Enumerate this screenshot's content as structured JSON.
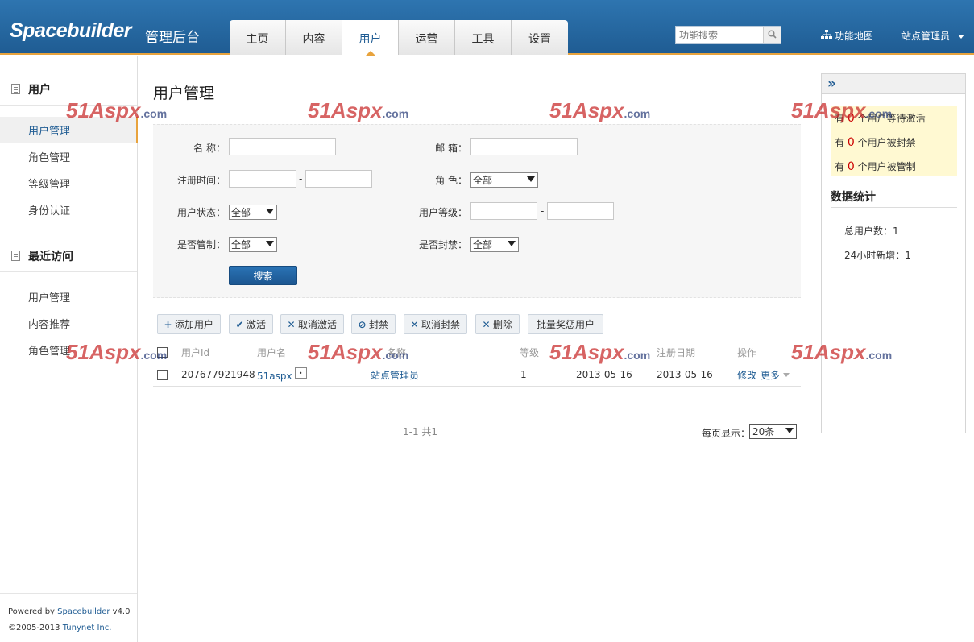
{
  "header": {
    "logo": "Spacebuilder",
    "subtitle": "管理后台",
    "tabs": [
      {
        "label": "主页"
      },
      {
        "label": "内容"
      },
      {
        "label": "用户",
        "active": true
      },
      {
        "label": "运营"
      },
      {
        "label": "工具"
      },
      {
        "label": "设置"
      }
    ],
    "search_placeholder": "功能搜索",
    "sitemap_label": "功能地图",
    "admin_label": "站点管理员"
  },
  "sidebar": {
    "section1_title": "用户",
    "section1_items": [
      {
        "label": "用户管理",
        "active": true
      },
      {
        "label": "角色管理"
      },
      {
        "label": "等级管理"
      },
      {
        "label": "身份认证"
      }
    ],
    "section2_title": "最近访问",
    "section2_items": [
      {
        "label": "用户管理"
      },
      {
        "label": "内容推荐"
      },
      {
        "label": "角色管理"
      }
    ],
    "powered_prefix": "Powered by ",
    "powered_link": "Spacebuilder",
    "powered_version": " v4.0",
    "copyright_prefix": "©2005-2013 ",
    "copyright_link": "Tunynet Inc."
  },
  "main": {
    "title": "用户管理",
    "filters": {
      "name_label": "名 称：",
      "email_label": "邮 箱：",
      "regtime_label": "注册时间：",
      "role_label": "角 色：",
      "role_value": "全部",
      "status_label": "用户状态：",
      "status_value": "全部",
      "level_label": "用户等级：",
      "moderated_label": "是否管制：",
      "moderated_value": "全部",
      "banned_label": "是否封禁：",
      "banned_value": "全部",
      "dash": "-",
      "search_button": "搜索"
    },
    "toolbar": {
      "add_user": "添加用户",
      "activate": "激活",
      "cancel_activate": "取消激活",
      "ban": "封禁",
      "cancel_ban": "取消封禁",
      "delete": "删除",
      "batch_reward": "批量奖惩用户"
    },
    "table": {
      "headers": {
        "user_id": "用户Id",
        "user_name": "用户名",
        "display_name": "名称",
        "level": "等级",
        "reg_date": "注册日期",
        "actions": "操作"
      },
      "rows": [
        {
          "user_id": "207677921948",
          "user_name": "51aspx",
          "display_name": "站点管理员",
          "level": "1",
          "date1": "2013-05-16",
          "date2": "2013-05-16",
          "edit": "修改",
          "more": "更多"
        }
      ]
    },
    "pager": {
      "info": "1-1 共1",
      "per_page_label": "每页显示：",
      "per_page_value": "20条"
    }
  },
  "right_panel": {
    "notices": [
      {
        "prefix": "有 ",
        "num": "0",
        "suffix": " 个用户等待激活"
      },
      {
        "prefix": "有 ",
        "num": "0",
        "suffix": " 个用户被封禁"
      },
      {
        "prefix": "有 ",
        "num": "0",
        "suffix": " 个用户被管制"
      }
    ],
    "stats_title": "数据统计",
    "total_users": "总用户数：1",
    "new_24h": "24小时新增：1"
  },
  "watermark": {
    "big": "51Aspx",
    "small": ".com"
  },
  "colors": {
    "header_blue": "#1f5c93",
    "accent_orange": "#e8a33d",
    "notice_bg": "#fff9d2",
    "alert_red": "#cc0000"
  }
}
